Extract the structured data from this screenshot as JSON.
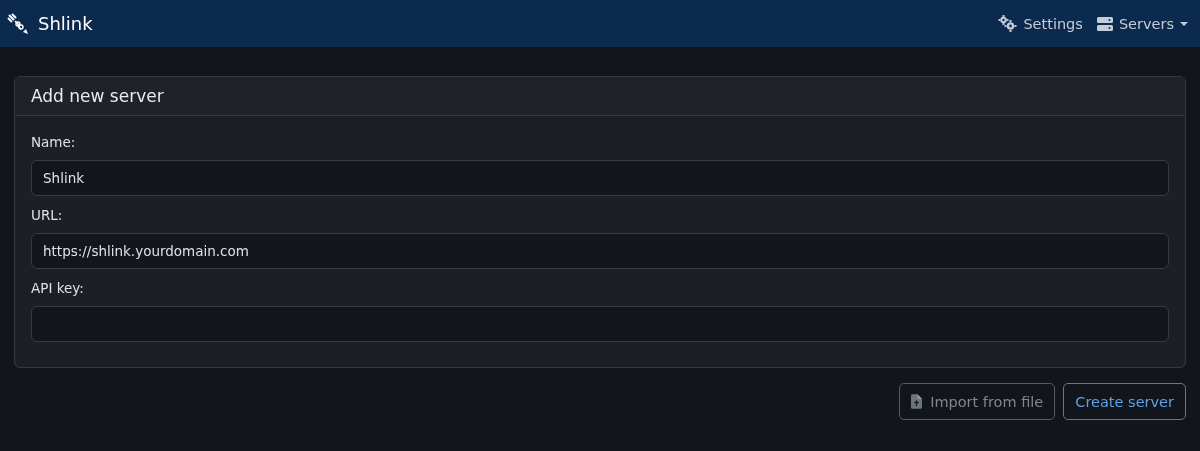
{
  "navbar": {
    "brand": "Shlink",
    "items": [
      {
        "kind": "settings",
        "label": "Settings"
      },
      {
        "kind": "servers",
        "label": "Servers",
        "dropdown": true
      }
    ]
  },
  "card": {
    "title": "Add new server",
    "fields": [
      {
        "label": "Name:",
        "value": "Shlink"
      },
      {
        "label": "URL:",
        "value": "https://shlink.yourdomain.com"
      },
      {
        "label": "API key:"
      }
    ]
  },
  "buttons": [
    {
      "kind": "import",
      "label": "Import from file"
    },
    {
      "kind": "create",
      "label": "Create server"
    }
  ]
}
